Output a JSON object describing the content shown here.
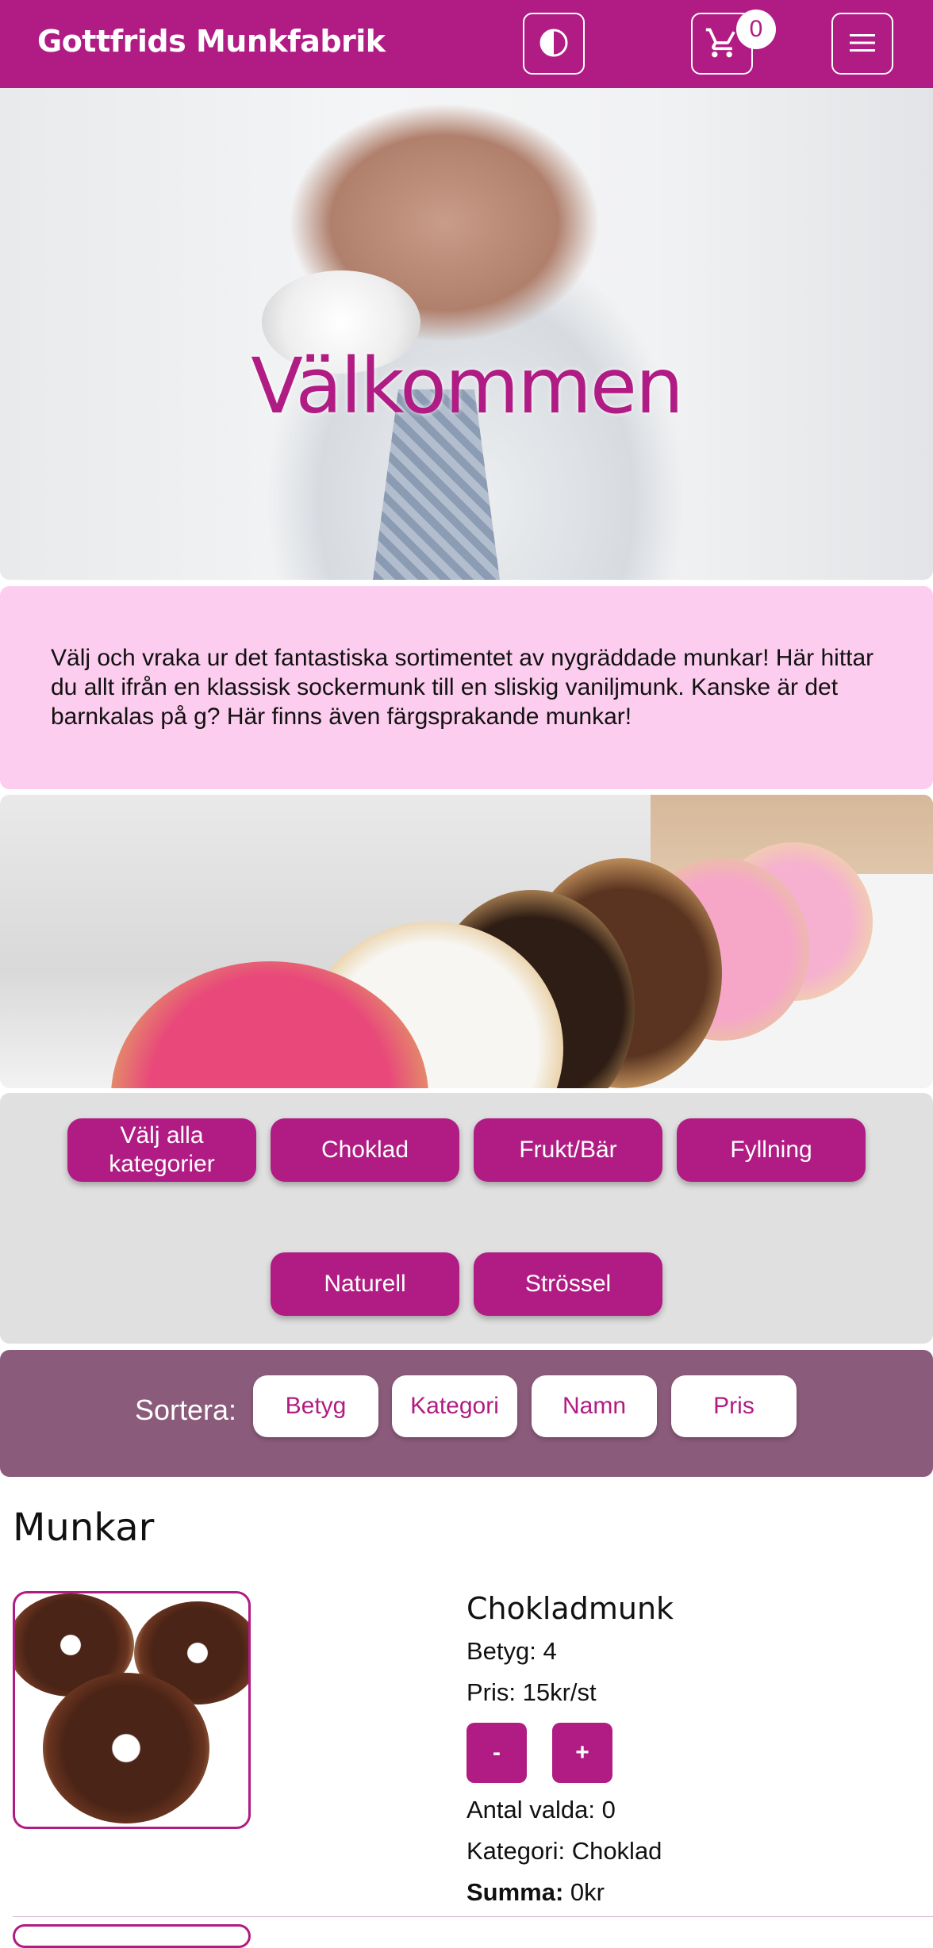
{
  "header": {
    "brand": "Gottfrids Munkfabrik",
    "contrast_icon": "contrast-icon",
    "cart_icon": "cart-icon",
    "cart_count": "0",
    "menu_icon": "hamburger-menu-icon"
  },
  "hero": {
    "title": "Välkommen"
  },
  "intro": {
    "text": "Välj och vraka ur det fantastiska sortimentet av nygräddade munkar! Här hittar du allt ifrån en klassisk sockermunk till en sliskig vaniljmunk. Kanske är det barnkalas på g? Här finns även färgsprakande munkar!"
  },
  "categories": {
    "items": [
      "Välj alla kategorier",
      "Choklad",
      "Frukt/Bär",
      "Fyllning",
      "Naturell",
      "Strössel"
    ]
  },
  "sort": {
    "label": "Sortera:",
    "options": [
      "Betyg",
      "Kategori",
      "Namn",
      "Pris"
    ]
  },
  "products": {
    "heading": "Munkar",
    "items": [
      {
        "name": "Chokladmunk",
        "rating": "Betyg: 4",
        "price": "Pris: 15kr/st",
        "decrease": "-",
        "increase": "+",
        "selected": "Antal valda: 0",
        "category": "Kategori: Choklad",
        "sum_label": "Summa:",
        "sum_value": " 0kr"
      }
    ]
  },
  "colors": {
    "accent": "#b01c83",
    "intro_bg": "#fccdee",
    "sort_bg": "#8b5b7b",
    "cats_bg": "#e0e0e0"
  }
}
